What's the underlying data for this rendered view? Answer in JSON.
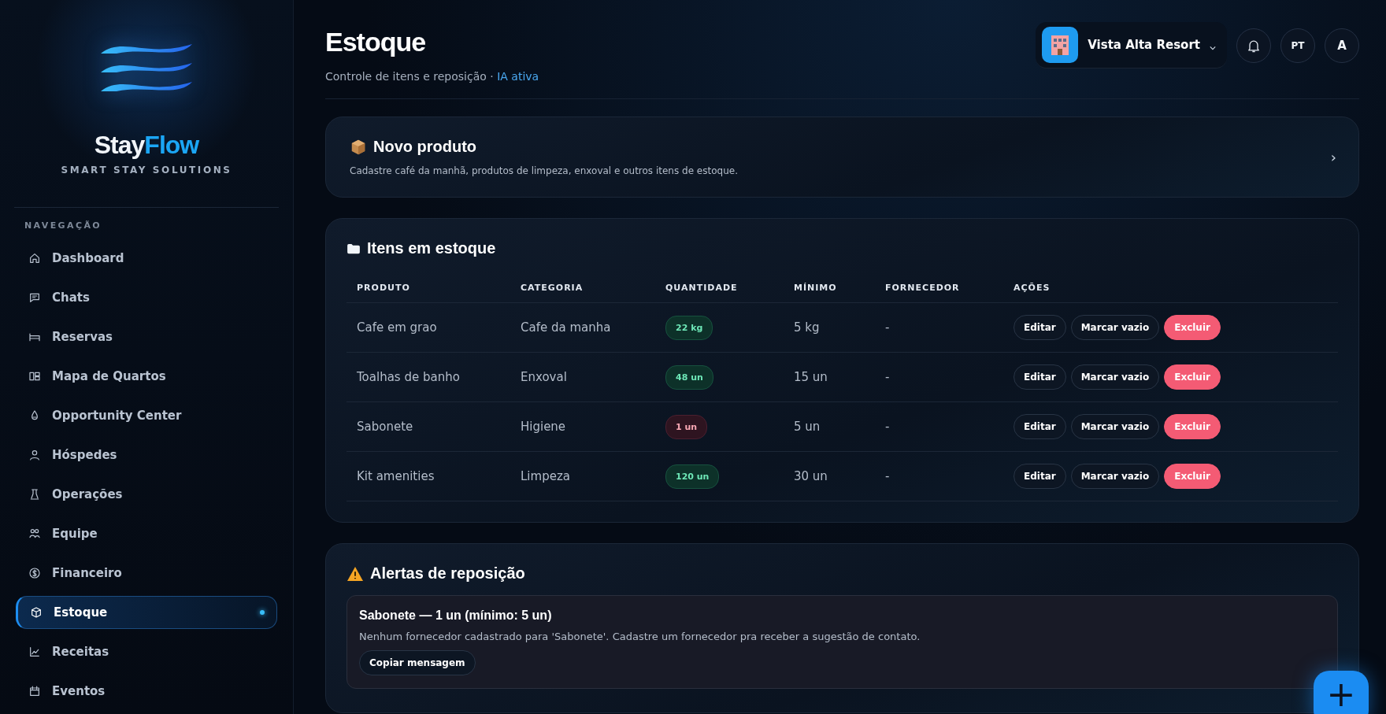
{
  "brand": {
    "name_part_1": "Stay",
    "name_part_2": "Flow",
    "tagline": "SMART STAY SOLUTIONS"
  },
  "sidebar": {
    "section_title": "NAVEGAÇÃO",
    "items": [
      {
        "label": "Dashboard",
        "selected": false
      },
      {
        "label": "Chats",
        "selected": false
      },
      {
        "label": "Reservas",
        "selected": false
      },
      {
        "label": "Mapa de Quartos",
        "selected": false
      },
      {
        "label": "Opportunity Center",
        "selected": false
      },
      {
        "label": "Hóspedes",
        "selected": false
      },
      {
        "label": "Operações",
        "selected": false
      },
      {
        "label": "Equipe",
        "selected": false
      },
      {
        "label": "Financeiro",
        "selected": false
      },
      {
        "label": "Estoque",
        "selected": true
      },
      {
        "label": "Receitas",
        "selected": false
      },
      {
        "label": "Eventos",
        "selected": false
      }
    ]
  },
  "header": {
    "title": "Estoque",
    "subtitle": "Controle de itens e reposição ·",
    "ai_status": "IA ativa",
    "property": "Vista Alta Resort",
    "language": "PT",
    "avatar": "A"
  },
  "new_product": {
    "title": "Novo produto",
    "description": "Cadastre café da manhã, produtos de limpeza, enxoval e outros itens de estoque.",
    "chevron": "›"
  },
  "stock": {
    "title": "Itens em estoque",
    "columns": [
      "PRODUTO",
      "CATEGORIA",
      "QUANTIDADE",
      "MÍNIMO",
      "FORNECEDOR",
      "AÇÕES"
    ],
    "rows": [
      {
        "product": "Cafe em grao",
        "category": "Cafe da manha",
        "quantity": "22 kg",
        "low": false,
        "minimum": "5 kg",
        "supplier": "-",
        "actions": [
          "Editar",
          "Marcar vazio",
          "Excluir"
        ]
      },
      {
        "product": "Toalhas de banho",
        "category": "Enxoval",
        "quantity": "48 un",
        "low": false,
        "minimum": "15 un",
        "supplier": "-",
        "actions": [
          "Editar",
          "Marcar vazio",
          "Excluir"
        ]
      },
      {
        "product": "Sabonete",
        "category": "Higiene",
        "quantity": "1 un",
        "low": true,
        "minimum": "5 un",
        "supplier": "-",
        "actions": [
          "Editar",
          "Marcar vazio",
          "Excluir"
        ]
      },
      {
        "product": "Kit amenities",
        "category": "Limpeza",
        "quantity": "120 un",
        "low": false,
        "minimum": "30 un",
        "supplier": "-",
        "actions": [
          "Editar",
          "Marcar vazio",
          "Excluir"
        ]
      }
    ]
  },
  "alerts": {
    "title": "Alertas de reposição",
    "items": [
      {
        "title": "Sabonete — 1 un (mínimo: 5 un)",
        "message": "Nenhum fornecedor cadastrado para 'Sabonete'. Cadastre um fornecedor pra receber a sugestão de contato.",
        "button": "Copiar mensagem"
      }
    ]
  },
  "fab": {
    "label": "+"
  }
}
